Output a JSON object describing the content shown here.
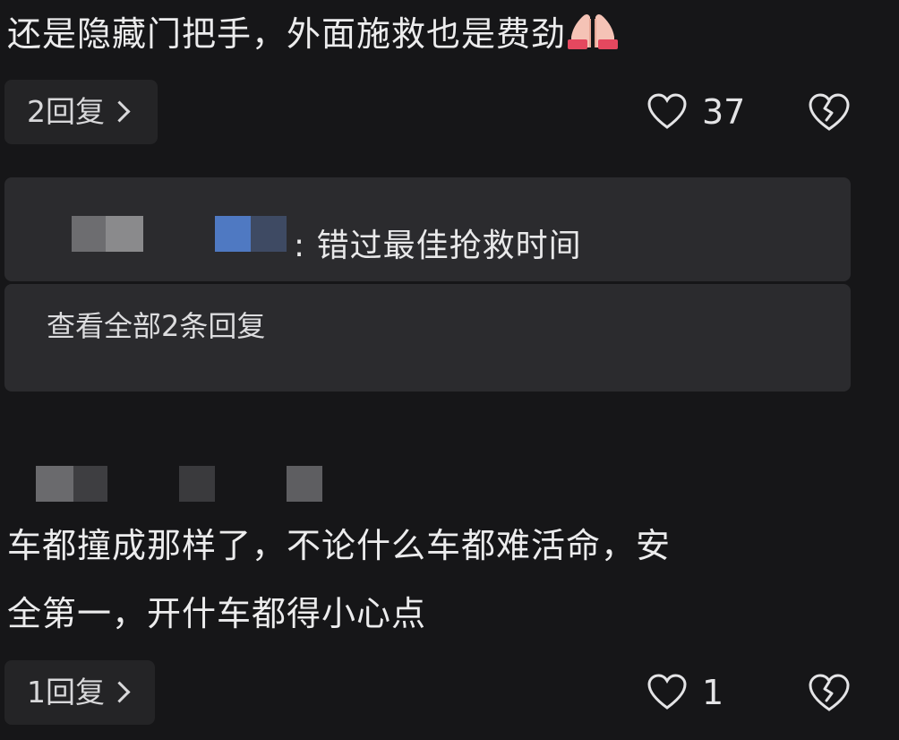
{
  "comments": [
    {
      "text": "还是隐藏门把手，外面施救也是费劲",
      "emoji": "folded-hands",
      "reply_button": "2回复",
      "likes": "37",
      "sub_reply": {
        "text": ": 错过最佳抢救时间"
      },
      "view_all": "查看全部2条回复"
    },
    {
      "text": "车都撞成那样了，不论什么车都难活命，安\n全第一，开什车都得小心点",
      "reply_button": "1回复",
      "likes": "1"
    }
  ],
  "colors": {
    "background": "#161618",
    "card": "#2b2b2e",
    "pill": "#242426",
    "text": "#ececed",
    "censor_blue": "#4f79c2"
  },
  "icons": {
    "like": "heart-outline-icon",
    "dislike": "broken-heart-icon",
    "reply_more": "chevron-right-icon"
  }
}
